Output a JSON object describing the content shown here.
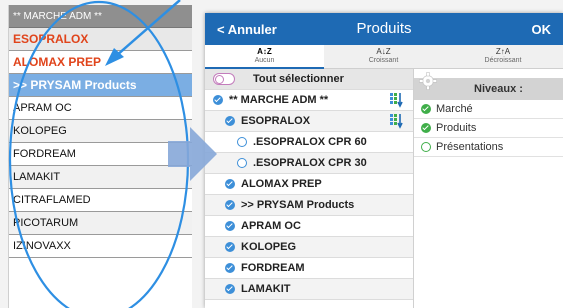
{
  "left_list": {
    "header": "** MARCHE ADM **",
    "items": [
      {
        "label": "ESOPRALOX"
      },
      {
        "label": "ALOMAX PREP"
      },
      {
        "label": ">> PRYSAM Products"
      },
      {
        "label": "APRAM OC"
      },
      {
        "label": "KOLOPEG"
      },
      {
        "label": "FORDREAM"
      },
      {
        "label": "LAMAKIT"
      },
      {
        "label": "CITRAFLAMED"
      },
      {
        "label": "PICOTARUM"
      },
      {
        "label": "IZINOVAXX"
      }
    ]
  },
  "modal": {
    "cancel_label": "< Annuler",
    "title": "Produits",
    "ok_label": "OK",
    "sort_tabs": [
      {
        "icon_text": "A↕Z",
        "label": "Aucun",
        "active": true
      },
      {
        "icon_text": "A↓Z",
        "label": "Croissant",
        "active": false
      },
      {
        "icon_text": "Z↑A",
        "label": "Décroissant",
        "active": false
      }
    ],
    "select_all_label": "Tout sélectionner",
    "tree": [
      {
        "label": "** MARCHE ADM **",
        "state": "checked",
        "sort_icon": true
      },
      {
        "label": "ESOPRALOX",
        "state": "checked",
        "sort_icon": true
      },
      {
        "label": ".ESOPRALOX CPR 60",
        "state": "unchecked",
        "sort_icon": false
      },
      {
        "label": ".ESOPRALOX CPR 30",
        "state": "unchecked",
        "sort_icon": false
      },
      {
        "label": "ALOMAX PREP",
        "state": "checked",
        "sort_icon": false
      },
      {
        "label": ">> PRYSAM Products",
        "state": "checked",
        "sort_icon": false
      },
      {
        "label": "APRAM OC",
        "state": "checked",
        "sort_icon": false
      },
      {
        "label": "KOLOPEG",
        "state": "checked",
        "sort_icon": false
      },
      {
        "label": "FORDREAM",
        "state": "checked",
        "sort_icon": false
      },
      {
        "label": "LAMAKIT",
        "state": "checked",
        "sort_icon": false
      }
    ],
    "levels": {
      "title": "Niveaux :",
      "items": [
        {
          "label": "Marché",
          "state": "checked"
        },
        {
          "label": "Produits",
          "state": "checked"
        },
        {
          "label": "Présentations",
          "state": "unchecked"
        }
      ]
    }
  },
  "colors": {
    "header_blue": "#1e6ab4",
    "accent_orange": "#e0441b",
    "check_blue": "#3d8fd8",
    "check_green": "#3fae49",
    "annotation_blue": "#2e8fe3"
  }
}
